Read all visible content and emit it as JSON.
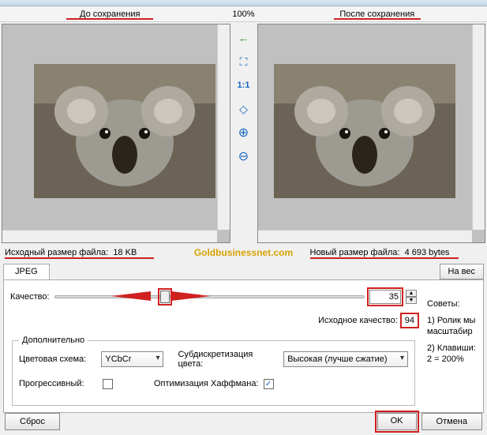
{
  "header": {
    "before_label": "До сохранения",
    "zoom_percent": "100%",
    "after_label": "После сохранения"
  },
  "toolbar_icons": {
    "arrow_left": "←",
    "fit_screen": "⛶",
    "one_to_one": "1:1",
    "fit_window": "◇",
    "zoom_in": "zoom-in-icon",
    "zoom_out": "zoom-out-icon"
  },
  "filesize": {
    "original_label": "Исходный размер файла:",
    "original_value": "18 KB",
    "new_label": "Новый размер файла:",
    "new_value": "4 693 bytes"
  },
  "watermark": "Goldbusinessnet.com",
  "tab": {
    "jpeg": "JPEG"
  },
  "fullscreen_btn": "На вес",
  "quality": {
    "label": "Качество:",
    "value": "35",
    "orig_label": "Исходное качество:",
    "orig_value": "94"
  },
  "extra": {
    "legend": "Дополнительно",
    "color_scheme_label": "Цветовая схема:",
    "color_scheme_value": "YCbCr",
    "subsampling_label": "Субдискретизация цвета:",
    "subsampling_value": "Высокая (лучше сжатие)",
    "progressive_label": "Прогрессивный:",
    "progressive_checked": false,
    "huffman_label": "Оптимизация Хаффмана:",
    "huffman_checked": true
  },
  "tips": {
    "title": "Советы:",
    "t1": "1) Ролик мы масштабир",
    "t2": "2) Клавиши: 2 = 200%"
  },
  "buttons": {
    "reset": "Сброс",
    "ok": "OK",
    "cancel": "Отмена"
  }
}
